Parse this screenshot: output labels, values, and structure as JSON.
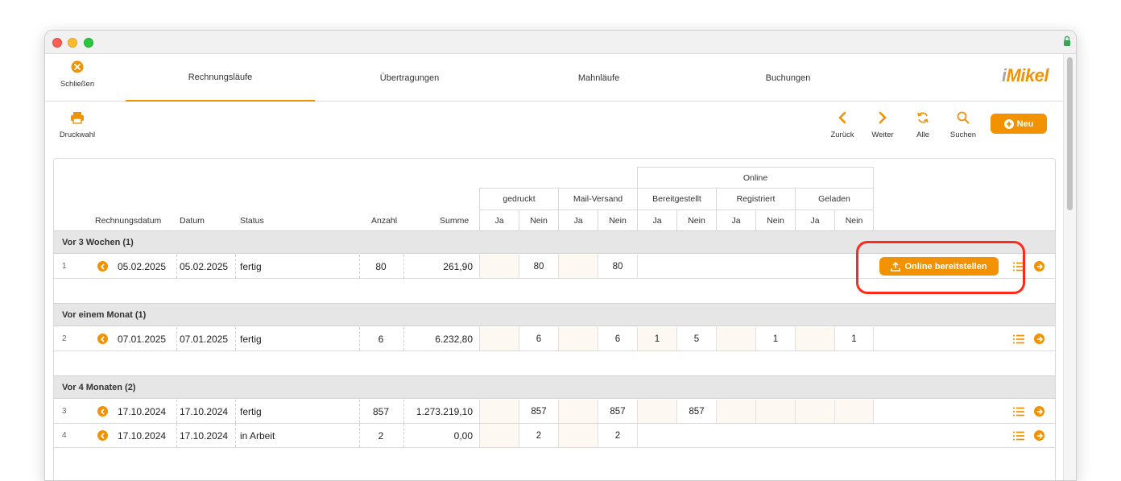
{
  "nav": {
    "close_label": "Schließen",
    "tabs": [
      {
        "label": "Rechnungsläufe",
        "active": true
      },
      {
        "label": "Übertragungen",
        "active": false
      },
      {
        "label": "Mahnläufe",
        "active": false
      },
      {
        "label": "Buchungen",
        "active": false
      }
    ],
    "logo_prefix": "i",
    "logo_main": "Mikel"
  },
  "toolbar": {
    "print_label": "Druckwahl",
    "back_label": "Zurück",
    "next_label": "Weiter",
    "all_label": "Alle",
    "search_label": "Suchen",
    "new_label": "Neu"
  },
  "table": {
    "headers": {
      "rechnungsdatum": "Rechnungsdatum",
      "datum": "Datum",
      "status": "Status",
      "anzahl": "Anzahl",
      "summe": "Summe",
      "online": "Online",
      "gedruckt": "gedruckt",
      "mail": "Mail-Versand",
      "bereitgestellt": "Bereitgestellt",
      "registriert": "Registriert",
      "geladen": "Geladen",
      "ja": "Ja",
      "nein": "Nein"
    },
    "groups": [
      {
        "title": "Vor 3 Wochen (1)"
      },
      {
        "title": "Vor einem Monat (1)"
      },
      {
        "title": "Vor 4 Monaten (2)"
      }
    ],
    "rows": [
      {
        "nr": "1",
        "rechnungsdatum": "05.02.2025",
        "datum": "05.02.2025",
        "status": "fertig",
        "anzahl": "80",
        "summe": "261,90",
        "gedruckt_ja": "",
        "gedruckt_nein": "80",
        "mail_ja": "",
        "mail_nein": "80",
        "action_label": "Online bereitstellen"
      },
      {
        "nr": "2",
        "rechnungsdatum": "07.01.2025",
        "datum": "07.01.2025",
        "status": "fertig",
        "anzahl": "6",
        "summe": "6.232,80",
        "gedruckt_ja": "",
        "gedruckt_nein": "6",
        "mail_ja": "",
        "mail_nein": "6",
        "bereit_ja": "1",
        "bereit_nein": "5",
        "reg_ja": "",
        "reg_nein": "1",
        "gel_ja": "",
        "gel_nein": "1"
      },
      {
        "nr": "3",
        "rechnungsdatum": "17.10.2024",
        "datum": "17.10.2024",
        "status": "fertig",
        "anzahl": "857",
        "summe": "1.273.219,10",
        "gedruckt_ja": "",
        "gedruckt_nein": "857",
        "mail_ja": "",
        "mail_nein": "857",
        "bereit_ja": "",
        "bereit_nein": "857",
        "reg_ja": "",
        "reg_nein": "",
        "gel_ja": "",
        "gel_nein": ""
      },
      {
        "nr": "4",
        "rechnungsdatum": "17.10.2024",
        "datum": "17.10.2024",
        "status": "in Arbeit",
        "anzahl": "2",
        "summe": "0,00",
        "gedruckt_ja": "",
        "gedruckt_nein": "2",
        "mail_ja": "",
        "mail_nein": "2"
      }
    ]
  },
  "colors": {
    "accent": "#f39200",
    "highlight": "#ff2a1a"
  }
}
